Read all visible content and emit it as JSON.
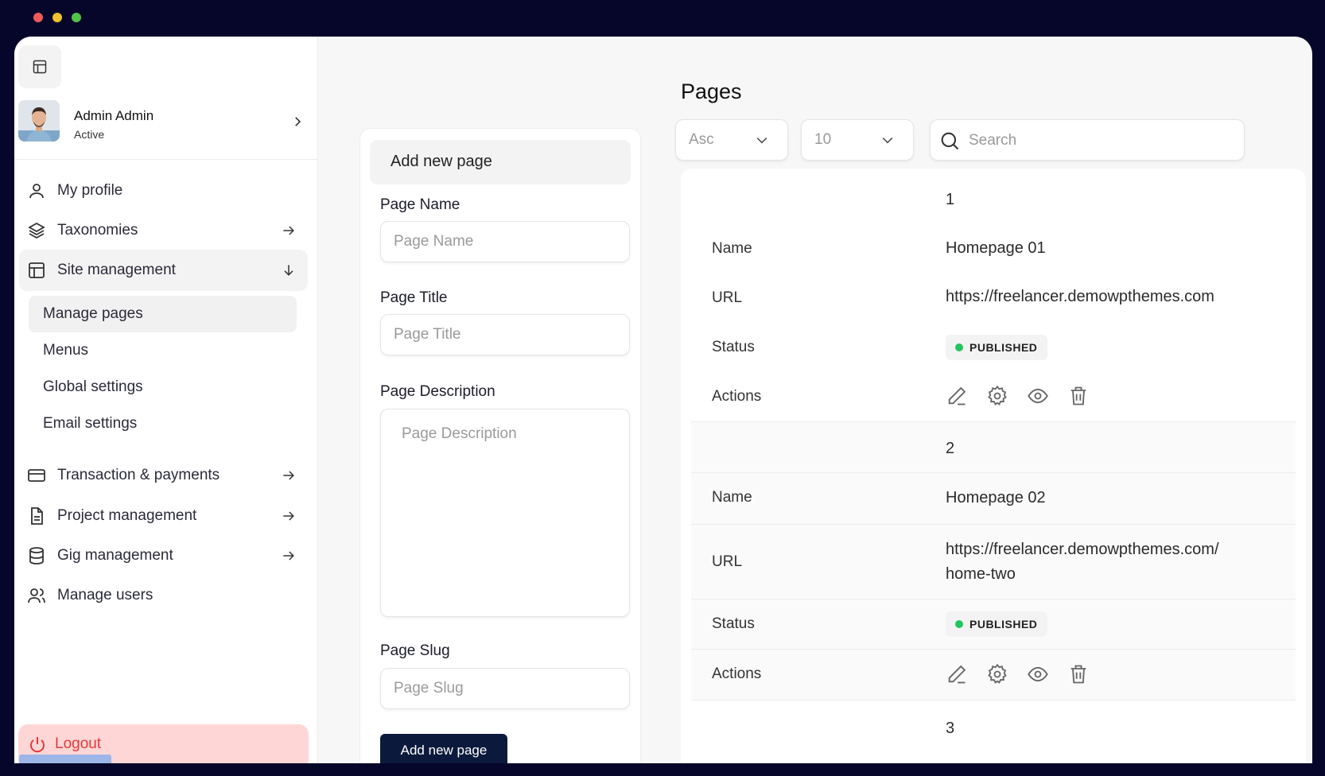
{
  "user": {
    "name": "Admin Admin",
    "status": "Active"
  },
  "sidebar": {
    "items": [
      {
        "label": "My profile",
        "icon": "user-icon"
      },
      {
        "label": "Taxonomies",
        "icon": "layers-icon"
      },
      {
        "label": "Site management",
        "icon": "layout-icon"
      },
      {
        "label": "Transaction & payments",
        "icon": "credit-card-icon"
      },
      {
        "label": "Project management",
        "icon": "file-icon"
      },
      {
        "label": "Gig management",
        "icon": "database-icon"
      },
      {
        "label": "Manage users",
        "icon": "users-icon"
      }
    ],
    "subitems": [
      "Manage pages",
      "Menus",
      "Global settings",
      "Email settings"
    ],
    "logout": "Logout"
  },
  "form": {
    "title": "Add new page",
    "name_label": "Page Name",
    "name_placeholder": "Page Name",
    "title_label": "Page Title",
    "title_placeholder": "Page Title",
    "desc_label": "Page Description",
    "desc_placeholder": "Page Description",
    "slug_label": "Page Slug",
    "slug_placeholder": "Page Slug",
    "submit": "Add new page"
  },
  "pages": {
    "title": "Pages",
    "sort": "Asc",
    "per_page": "10",
    "search_placeholder": "Search",
    "labels": {
      "name": "Name",
      "url": "URL",
      "status": "Status",
      "actions": "Actions"
    },
    "rows": [
      {
        "index": "1",
        "name": "Homepage 01",
        "url": "https://freelancer.demowpthemes.com",
        "status": "PUBLISHED"
      },
      {
        "index": "2",
        "name": "Homepage 02",
        "url": "https://freelancer.demowpthemes.com/ home-two",
        "status": "PUBLISHED"
      },
      {
        "index": "3"
      }
    ]
  },
  "colors": {
    "navy": "#0b1a3c",
    "published": "#22c55e",
    "logout_bg": "#ffd6d6",
    "logout_text": "#e03a3a"
  }
}
